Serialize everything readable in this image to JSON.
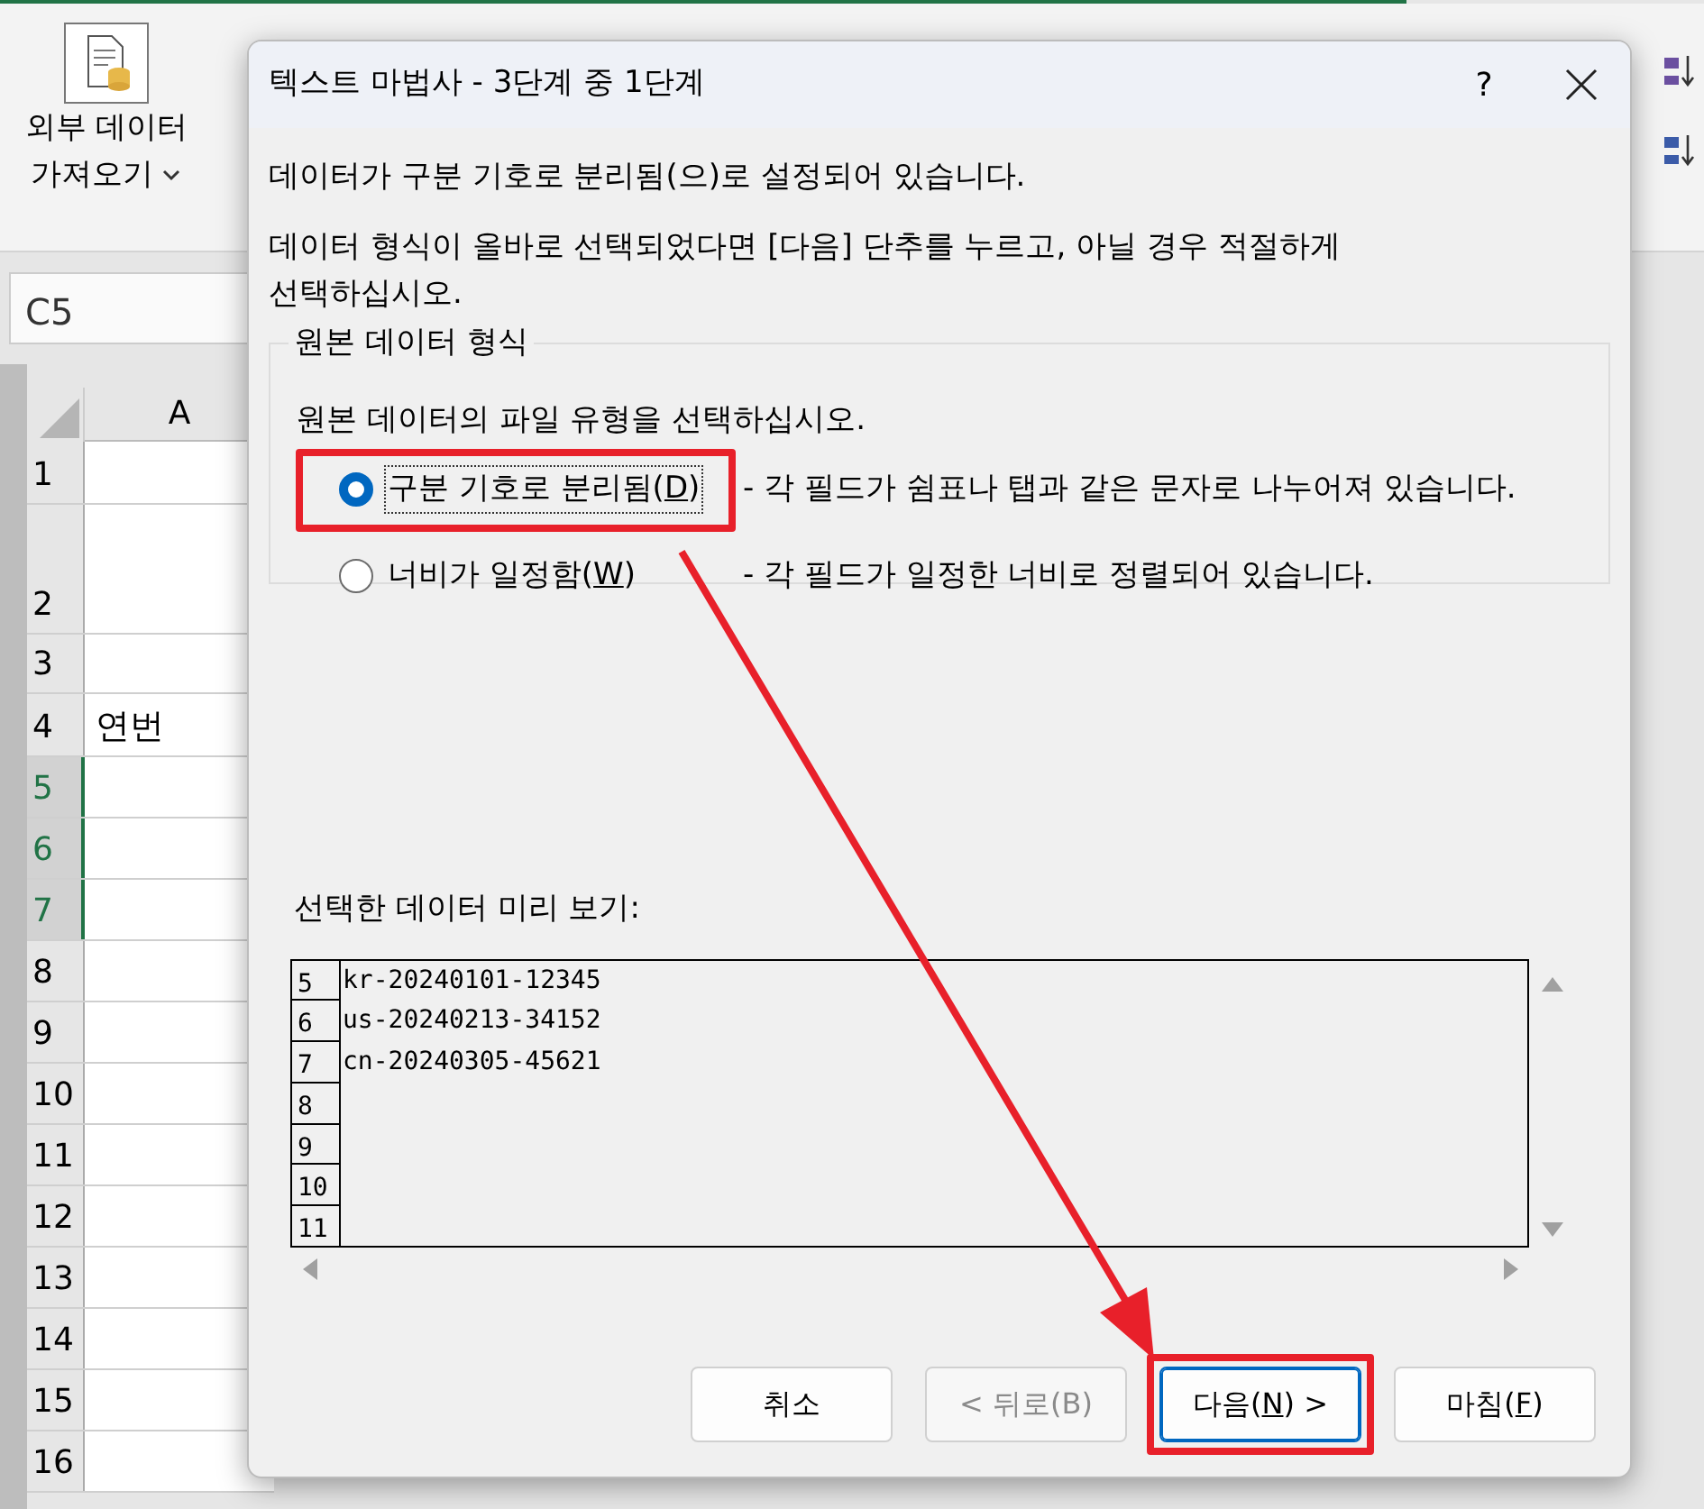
{
  "excel": {
    "import_button": {
      "lines": [
        "외부 데이터",
        "가져오기"
      ]
    },
    "name_box": "C5",
    "column_header": "A",
    "rows": [
      {
        "number": "1",
        "selected": false
      },
      {
        "number": "2",
        "selected": false
      },
      {
        "number": "3",
        "selected": false
      },
      {
        "number": "4",
        "selected": false,
        "cell": "연번"
      },
      {
        "number": "5",
        "selected": true
      },
      {
        "number": "6",
        "selected": true
      },
      {
        "number": "7",
        "selected": true
      },
      {
        "number": "8",
        "selected": false
      },
      {
        "number": "9",
        "selected": false
      },
      {
        "number": "10",
        "selected": false
      },
      {
        "number": "11",
        "selected": false
      },
      {
        "number": "12",
        "selected": false
      },
      {
        "number": "13",
        "selected": false
      },
      {
        "number": "14",
        "selected": false
      },
      {
        "number": "15",
        "selected": false
      },
      {
        "number": "16",
        "selected": false
      }
    ]
  },
  "dialog": {
    "title": "텍스트 마법사 - 3단계 중 1단계",
    "help": "?",
    "intro": "데이터가 구분 기호로 분리됨(으)로 설정되어 있습니다.",
    "instruction": "데이터 형식이 올바로 선택되었다면 [다음] 단추를 누르고, 아닐 경우 적절하게 선택하십시오.",
    "group": {
      "legend": "원본 데이터 형식",
      "prompt": "원본 데이터의 파일 유형을 선택하십시오.",
      "options": [
        {
          "label": "구분 기호로 분리됨(",
          "key": "D",
          "label_end": ")",
          "description": "- 각 필드가 쉼표나 탭과 같은 문자로 나누어져 있습니다.",
          "selected": true,
          "highlighted": true
        },
        {
          "label": "너비가 일정함(",
          "key": "W",
          "label_end": ")",
          "description": "- 각 필드가 일정한 너비로 정렬되어 있습니다.",
          "selected": false,
          "highlighted": false
        }
      ]
    },
    "preview": {
      "label": "선택한 데이터 미리 보기:",
      "lines": [
        {
          "number": "5",
          "text": "kr-20240101-12345"
        },
        {
          "number": "6",
          "text": "us-20240213-34152"
        },
        {
          "number": "7",
          "text": "cn-20240305-45621"
        },
        {
          "number": "8"
        },
        {
          "number": "9"
        },
        {
          "number": "10"
        },
        {
          "number": "11"
        }
      ]
    },
    "buttons": [
      {
        "label": "취소",
        "disabled": false,
        "default": false,
        "highlighted": false
      },
      {
        "label": "< 뒤로(B)",
        "disabled": true,
        "default": false,
        "highlighted": false
      },
      {
        "label": "다음(",
        "key": "N",
        "label_end": ") >",
        "disabled": false,
        "default": true,
        "highlighted": true
      },
      {
        "label": "마침(",
        "key": "F",
        "label_end": ")",
        "disabled": false,
        "default": false,
        "highlighted": false
      }
    ]
  }
}
